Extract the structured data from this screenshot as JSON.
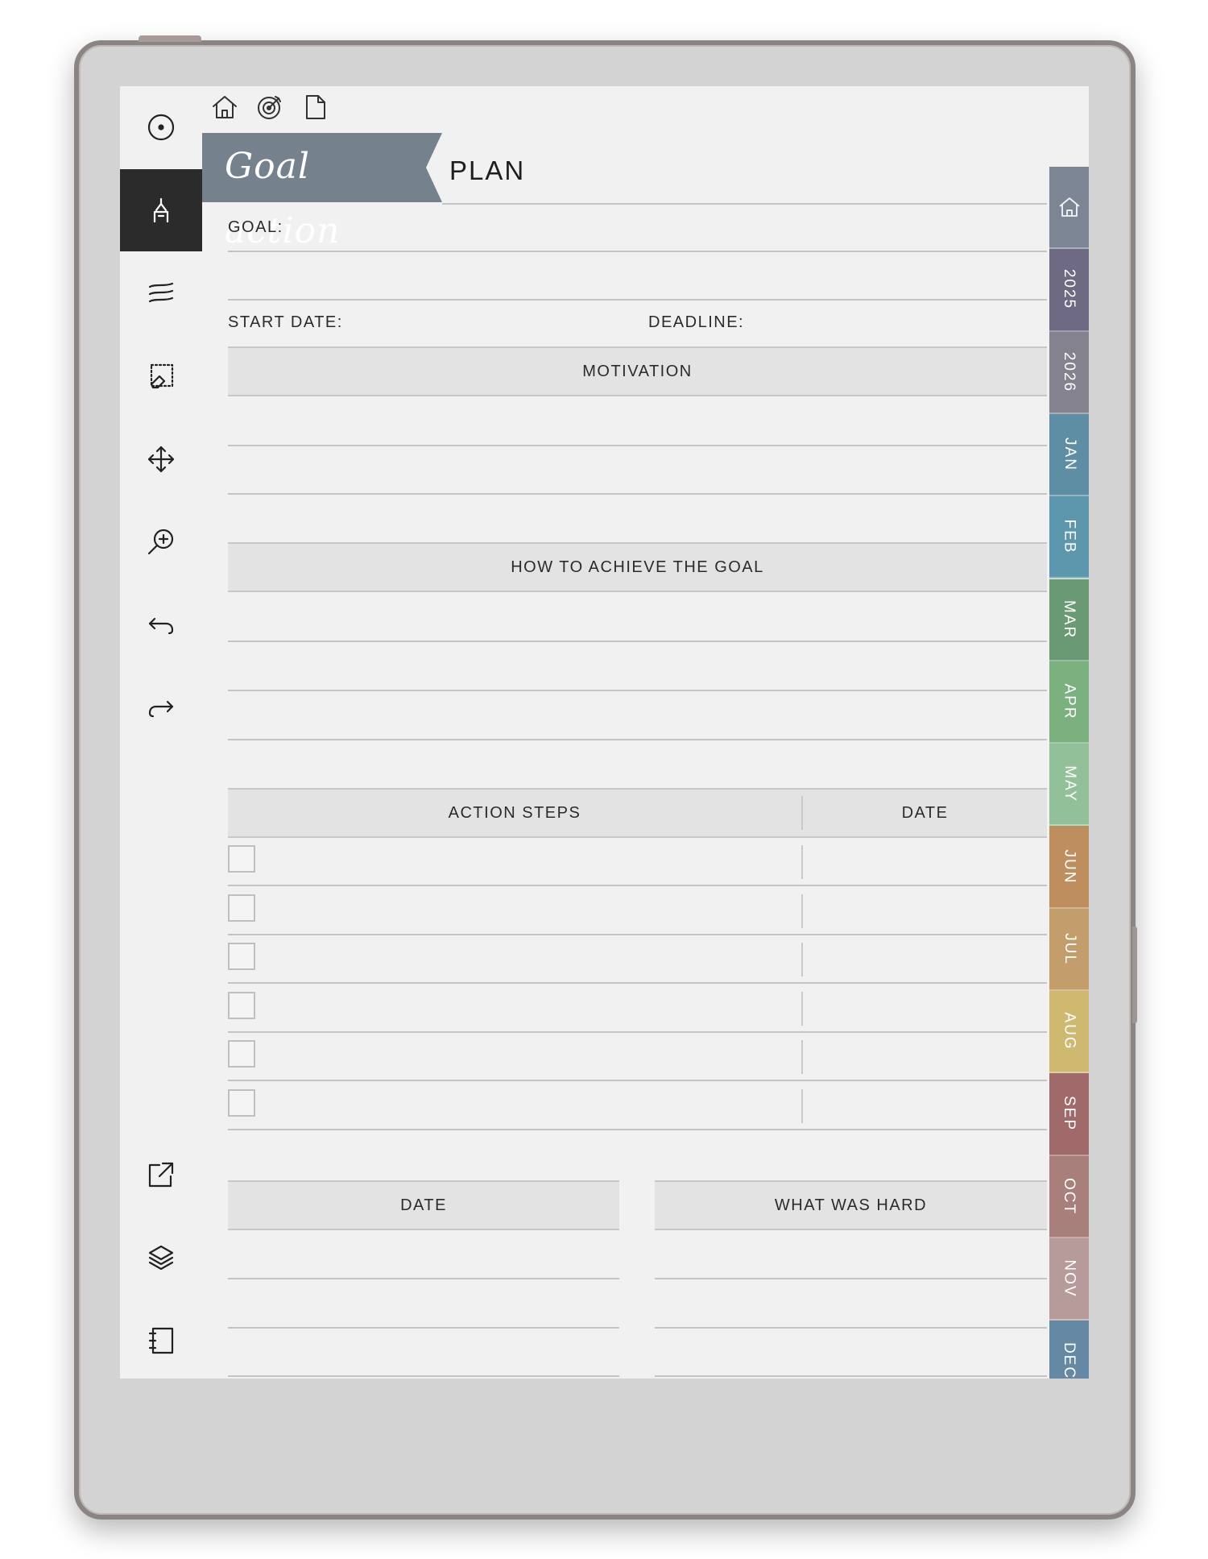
{
  "page": {
    "title_script": "Goal action",
    "title_word": "PLAN",
    "goal_label": "GOAL:",
    "start_date_label": "START DATE:",
    "deadline_label": "DEADLINE:",
    "motivation_header": "MOTIVATION",
    "how_header": "HOW TO ACHIEVE THE GOAL",
    "action_steps_header": "ACTION STEPS",
    "action_date_header": "DATE",
    "date_header": "DATE",
    "hard_header": "WHAT WAS HARD",
    "action_rows": 6
  },
  "toolbar": {
    "items": [
      {
        "name": "menu-circle-icon"
      },
      {
        "name": "pen-icon",
        "active": true
      },
      {
        "name": "brush-strokes-icon"
      },
      {
        "name": "eraser-select-icon"
      },
      {
        "name": "move-icon"
      },
      {
        "name": "zoom-icon"
      },
      {
        "name": "undo-icon"
      },
      {
        "name": "redo-icon"
      },
      {
        "name": "share-icon"
      },
      {
        "name": "layers-icon"
      },
      {
        "name": "notebook-icon"
      }
    ]
  },
  "topnav": [
    "home-icon",
    "target-icon",
    "page-icon"
  ],
  "tabs": [
    {
      "label": "",
      "icon": "home-icon",
      "color": "#7b8593"
    },
    {
      "label": "2025",
      "color": "#6e6a83"
    },
    {
      "label": "2026",
      "color": "#85828f"
    },
    {
      "label": "JAN",
      "color": "#5e8ea3"
    },
    {
      "label": "FEB",
      "color": "#5c97ad"
    },
    {
      "label": "MAR",
      "color": "#6a9a73"
    },
    {
      "label": "APR",
      "color": "#7bb07f"
    },
    {
      "label": "MAY",
      "color": "#92c199"
    },
    {
      "label": "JUN",
      "color": "#be8e5f"
    },
    {
      "label": "JUL",
      "color": "#c39e6c"
    },
    {
      "label": "AUG",
      "color": "#cfb870"
    },
    {
      "label": "SEP",
      "color": "#a06a6a"
    },
    {
      "label": "OCT",
      "color": "#a97f7c"
    },
    {
      "label": "NOV",
      "color": "#b79b9a"
    },
    {
      "label": "DEC",
      "color": "#6589a4"
    }
  ],
  "colors": {
    "banner": "#76818e",
    "screen_bg": "#f1f1f1",
    "header_bg": "#e3e3e3"
  }
}
